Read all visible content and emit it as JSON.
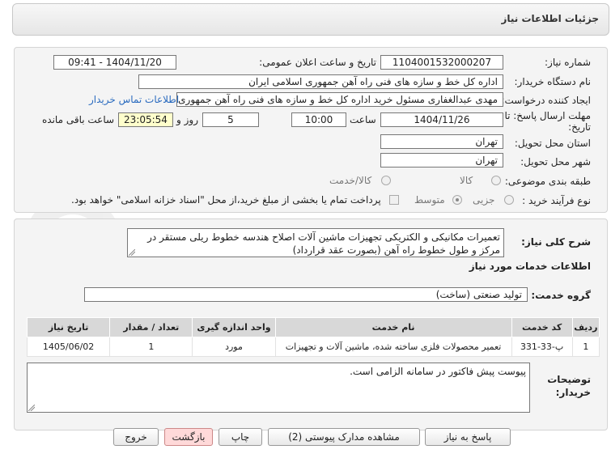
{
  "title": "جزئیات اطلاعات نیاز",
  "need_number": {
    "label": "شماره نیاز:",
    "value": "1104001532000207"
  },
  "announce_date": {
    "label": "تاریخ و ساعت اعلان عمومی:",
    "value": "1404/11/20 - 09:41"
  },
  "buyer_org": {
    "label": "نام دستگاه خریدار:",
    "value": "اداره کل خط و سازه های فنی راه آهن جمهوری اسلامی ایران"
  },
  "requester": {
    "label": "ایجاد کننده درخواست:",
    "value": "مهدی عبدالغفاری مسئول خرید اداره کل خط و سازه های فنی راه آهن جمهوری",
    "contact_link": "اطلاعات تماس خریدار"
  },
  "deadline": {
    "label_line1": "مهلت ارسال پاسخ: تا",
    "label_line2": "تاریخ:",
    "date": "1404/11/26",
    "time_label": "ساعت",
    "time": "10:00",
    "days": "5",
    "days_label": "روز و",
    "remaining": "23:05:54",
    "remaining_label": "ساعت باقی مانده"
  },
  "province": {
    "label": "استان محل تحویل:",
    "value": "تهران"
  },
  "city": {
    "label": "شهر محل تحویل:",
    "value": "تهران"
  },
  "category": {
    "label": "طبقه بندی موضوعی:",
    "options": [
      "کالا",
      "کالا/خدمت"
    ]
  },
  "process": {
    "label": "نوع فرآیند خرید :",
    "options": [
      "جزیی",
      "متوسط"
    ],
    "payment_note": "پرداخت تمام یا بخشی از مبلغ خرید،از محل \"اسناد خزانه اسلامی\" خواهد بود."
  },
  "summary": {
    "label": "شرح کلی نیاز:",
    "value": "تعمیرات مکانیکی و الکتریکی تجهیزات ماشین آلات اصلاح هندسه خطوط ریلی مستقر در مرکز و طول خطوط راه آهن (بصورت عقد قرارداد)"
  },
  "services_heading": "اطلاعات خدمات مورد نیاز",
  "service_group": {
    "label": "گروه خدمت:",
    "value": "تولید صنعتی (ساخت)"
  },
  "table": {
    "headers": [
      "ردیف",
      "کد خدمت",
      "نام خدمت",
      "واحد اندازه گیری",
      "تعداد / مقدار",
      "تاریخ نیاز"
    ],
    "rows": [
      [
        "1",
        "پ-33-331",
        "تعمیر محصولات فلزی ساخته شده، ماشین آلات و تجهیزات",
        "مورد",
        "1",
        "1405/06/02"
      ]
    ]
  },
  "buyer_notes": {
    "label_line1": "توضیحات",
    "label_line2": "خریدار:",
    "value": "پیوست پیش فاکتور در سامانه الزامی است."
  },
  "buttons": {
    "reply": "پاسخ به نیاز",
    "attachments": "مشاهده مدارک پیوستی (2)",
    "print": "چاپ",
    "back": "بازگشت",
    "exit": "خروج"
  },
  "colors": {
    "link": "#2a6bbf",
    "remaining_bg": "#ffffcc",
    "header_bg": "#d8d8d8",
    "pink_button": "#ffd9d9"
  }
}
